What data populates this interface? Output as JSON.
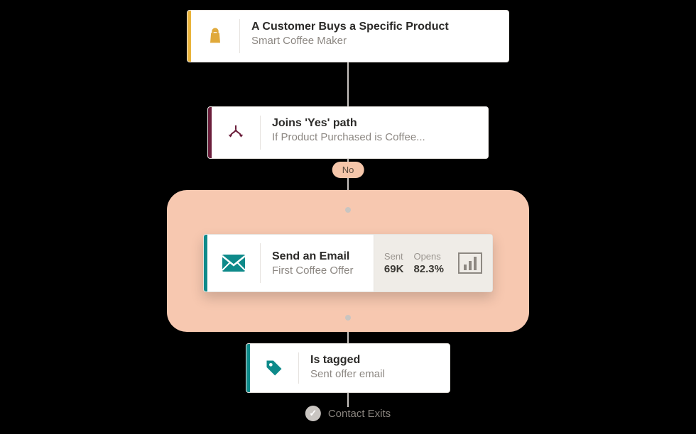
{
  "colors": {
    "accent_purchase": "#e9b33b",
    "accent_branch": "#6b1e3b",
    "accent_teal": "#0e8a8a",
    "highlight": "#f7c8b0",
    "pill": "#f5c6aa"
  },
  "flow": {
    "trigger": {
      "icon": "shopping-bag-icon",
      "title": "A Customer Buys a Specific Product",
      "subtitle": "Smart Coffee Maker"
    },
    "branch": {
      "icon": "split-path-icon",
      "title": "Joins 'Yes' path",
      "subtitle": "If Product Purchased is Coffee...",
      "no_label": "No"
    },
    "email": {
      "icon": "envelope-icon",
      "title": "Send an Email",
      "subtitle": "First Coffee Offer",
      "stats": {
        "sent_label": "Sent",
        "sent_value": "69K",
        "opens_label": "Opens",
        "opens_value": "82.3%"
      },
      "chart_icon": "bar-chart-icon"
    },
    "tag": {
      "icon": "tag-icon",
      "title": "Is tagged",
      "subtitle": "Sent offer email"
    },
    "exit": {
      "icon": "check-circle-icon",
      "label": "Contact Exits"
    }
  }
}
